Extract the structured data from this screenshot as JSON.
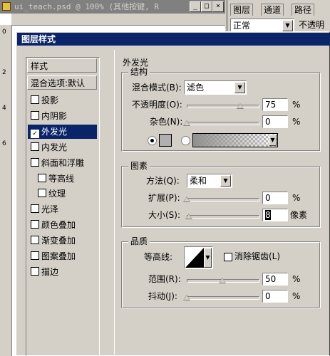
{
  "document": {
    "title": "ui_teach.psd @ 100% (其他按键, R",
    "window_buttons": [
      "_",
      "□",
      "×"
    ]
  },
  "layers_panel": {
    "tabs": [
      "图层",
      "通道",
      "路径"
    ],
    "blend_value": "正常",
    "opacity_label": "不透明"
  },
  "rulers": {
    "left_marks": [
      "0",
      "2",
      "4",
      "6"
    ]
  },
  "dialog": {
    "title": "图层样式",
    "sidebar": {
      "header": "样式",
      "blend_options": "混合选项:默认",
      "items": [
        {
          "label": "投影",
          "checked": false,
          "indent": false
        },
        {
          "label": "内阴影",
          "checked": false,
          "indent": false
        },
        {
          "label": "外发光",
          "checked": true,
          "indent": false,
          "selected": true
        },
        {
          "label": "内发光",
          "checked": false,
          "indent": false
        },
        {
          "label": "斜面和浮雕",
          "checked": false,
          "indent": false
        },
        {
          "label": "等高线",
          "checked": false,
          "indent": true
        },
        {
          "label": "纹理",
          "checked": false,
          "indent": true
        },
        {
          "label": "光泽",
          "checked": false,
          "indent": false
        },
        {
          "label": "颜色叠加",
          "checked": false,
          "indent": false
        },
        {
          "label": "渐变叠加",
          "checked": false,
          "indent": false
        },
        {
          "label": "图案叠加",
          "checked": false,
          "indent": false
        },
        {
          "label": "描边",
          "checked": false,
          "indent": false
        }
      ]
    },
    "outer_glow": {
      "section_title": "外发光",
      "structure": {
        "title": "结构",
        "blend_mode_label": "混合模式(B):",
        "blend_mode_value": "滤色",
        "opacity_label": "不透明度(O):",
        "opacity_value": "75",
        "opacity_unit": "%",
        "noise_label": "杂色(N):",
        "noise_value": "0",
        "noise_unit": "%",
        "opacity_level": 0.75,
        "noise_level": 0.0
      },
      "elements": {
        "title": "图素",
        "technique_label": "方法(Q):",
        "technique_value": "柔和",
        "spread_label": "扩展(P):",
        "spread_value": "0",
        "spread_unit": "%",
        "size_label": "大小(S):",
        "size_value": "8",
        "size_unit": "像素",
        "spread_level": 0.0,
        "size_level": 0.03
      },
      "quality": {
        "title": "品质",
        "contour_label": "等高线:",
        "antialias_label": "消除锯齿(L)",
        "range_label": "范围(R):",
        "range_value": "50",
        "range_unit": "%",
        "jitter_label": "抖动(J):",
        "jitter_value": "0",
        "jitter_unit": "%",
        "range_level": 0.5,
        "jitter_level": 0.0
      }
    }
  }
}
